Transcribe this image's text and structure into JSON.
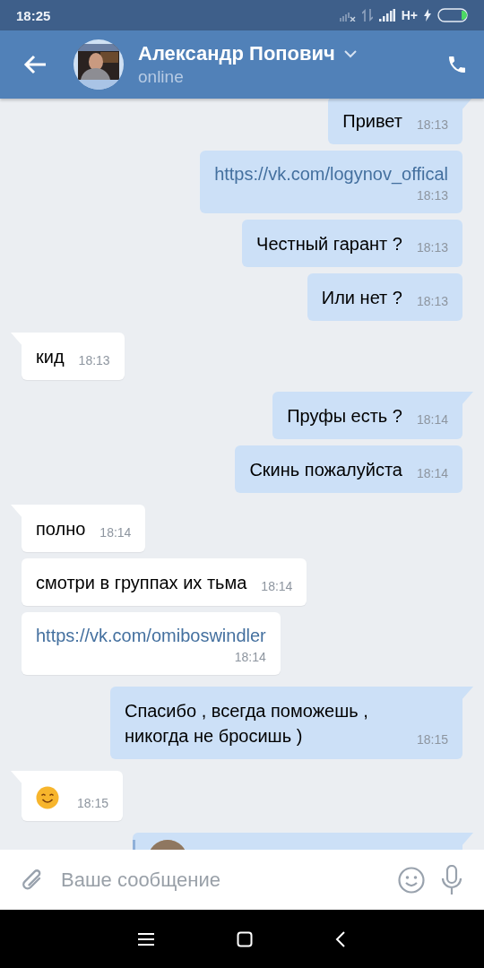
{
  "status_bar": {
    "time": "18:25",
    "network": "H+"
  },
  "header": {
    "name": "Александр Попович",
    "status": "online"
  },
  "messages": [
    {
      "kind": "text",
      "outgoing": true,
      "tail": true,
      "text": "Привет",
      "time": "18:13"
    },
    {
      "kind": "link",
      "outgoing": true,
      "tail": false,
      "text": "https://vk.com/logynov_offical",
      "time": "18:13"
    },
    {
      "kind": "text",
      "outgoing": true,
      "tail": false,
      "text": "Честный гарант ?",
      "time": "18:13"
    },
    {
      "kind": "text",
      "outgoing": true,
      "tail": false,
      "text": "Или нет ?",
      "time": "18:13"
    },
    {
      "kind": "text",
      "outgoing": false,
      "tail": true,
      "text": "кид",
      "time": "18:13"
    },
    {
      "kind": "text",
      "outgoing": true,
      "tail": true,
      "text": "Пруфы есть ?",
      "time": "18:14"
    },
    {
      "kind": "text",
      "outgoing": true,
      "tail": false,
      "text": "Скинь пожалуйста",
      "time": "18:14"
    },
    {
      "kind": "text",
      "outgoing": false,
      "tail": true,
      "text": "полно",
      "time": "18:14"
    },
    {
      "kind": "text",
      "outgoing": false,
      "tail": false,
      "text": "смотри в группах их тьма",
      "time": "18:14"
    },
    {
      "kind": "link",
      "outgoing": false,
      "tail": false,
      "text": "https://vk.com/omiboswindler",
      "time": "18:14"
    },
    {
      "kind": "text",
      "outgoing": true,
      "tail": true,
      "text": "Спасибо , всегда поможешь , никогда не бросишь )",
      "time": "18:15"
    },
    {
      "kind": "emoji",
      "outgoing": false,
      "tail": true,
      "time": "18:15"
    },
    {
      "kind": "forward",
      "outgoing": true,
      "tail": true
    }
  ],
  "composer": {
    "placeholder": "Ваше сообщение"
  }
}
